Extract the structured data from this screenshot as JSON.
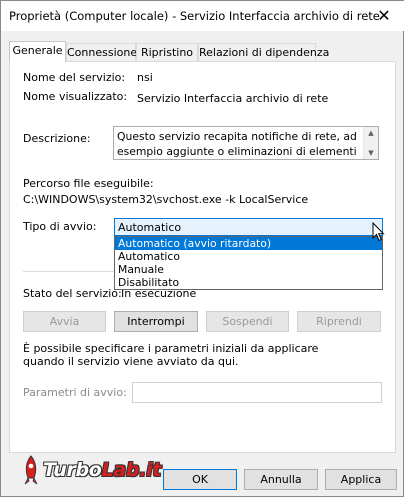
{
  "window": {
    "title": "Proprietà (Computer locale) - Servizio Interfaccia archivio di rete",
    "close_glyph": "✕"
  },
  "tabs": [
    {
      "label": "Generale",
      "active": true
    },
    {
      "label": "Connessione",
      "active": false
    },
    {
      "label": "Ripristino",
      "active": false
    },
    {
      "label": "Relazioni di dipendenza",
      "active": false
    }
  ],
  "general": {
    "service_name_label": "Nome del servizio:",
    "service_name_value": "nsi",
    "display_name_label": "Nome visualizzato:",
    "display_name_value": "Servizio Interfaccia archivio di rete",
    "description_label": "Descrizione:",
    "description_value": "Questo servizio recapita notifiche di rete, ad esempio aggiunte o eliminazioni di elementi dell'interfaccia, ai",
    "path_label": "Percorso file eseguibile:",
    "path_value": "C:\\WINDOWS\\system32\\svchost.exe -k LocalService",
    "startup_type_label": "Tipo di avvio:",
    "startup_type_value": "Automatico",
    "startup_options": [
      {
        "label": "Automatico (avvio ritardato)",
        "highlighted": true
      },
      {
        "label": "Automatico",
        "highlighted": false
      },
      {
        "label": "Manuale",
        "highlighted": false
      },
      {
        "label": "Disabilitato",
        "highlighted": false
      }
    ],
    "status_label": "Stato del servizio:",
    "status_value": "In esecuzione",
    "buttons": {
      "start": "Avvia",
      "stop": "Interrompi",
      "pause": "Sospendi",
      "resume": "Riprendi"
    },
    "params_note": "È possibile specificare i parametri iniziali da applicare quando il servizio viene avviato da qui.",
    "params_label": "Parametri di avvio:",
    "params_value": ""
  },
  "footer": {
    "ok": "OK",
    "cancel": "Annulla",
    "apply": "Applica"
  },
  "watermark": {
    "text_a": "Turbo",
    "text_b": "Lab.it"
  },
  "colors": {
    "accent": "#0078d7",
    "watermark_red": "#d62020"
  }
}
